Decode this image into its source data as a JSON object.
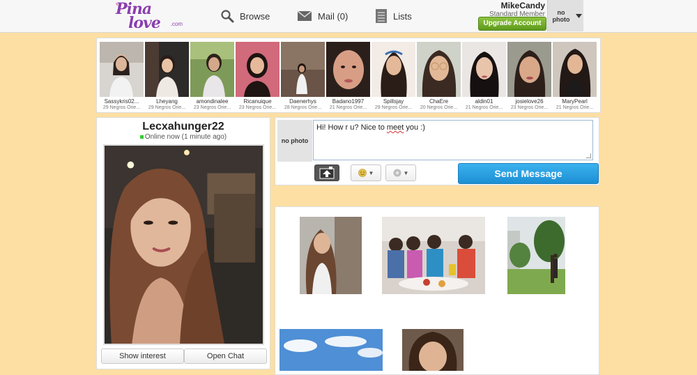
{
  "header": {
    "logo": {
      "line1": "Pina",
      "line2": "love",
      "suffix": ".com"
    },
    "nav": [
      {
        "label": "Browse",
        "icon": "search-icon"
      },
      {
        "label": "Mail (0)",
        "icon": "mail-icon"
      },
      {
        "label": "Lists",
        "icon": "list-icon"
      }
    ],
    "user": {
      "name": "MikeCandy",
      "membership": "Standard Member",
      "upgrade_label": "Upgrade Account",
      "photo_placeholder": "no photo"
    }
  },
  "strip": [
    {
      "name": "Sassykris02...",
      "meta": "29 Negros Orie..."
    },
    {
      "name": "Lheyang",
      "meta": "29 Negros Orie..."
    },
    {
      "name": "amondinalee",
      "meta": "23 Negros Orie..."
    },
    {
      "name": "Ricanuique",
      "meta": "23 Negros Orie..."
    },
    {
      "name": "Daenerhys",
      "meta": "28 Negros Orie..."
    },
    {
      "name": "Badano1997",
      "meta": "21 Negros Orie..."
    },
    {
      "name": "Spillsjay",
      "meta": "29 Negros Orie..."
    },
    {
      "name": "ChaEre",
      "meta": "20 Negros Orie..."
    },
    {
      "name": "aldin01",
      "meta": "21 Negros Orie..."
    },
    {
      "name": "josielove26",
      "meta": "23 Negros Orie..."
    },
    {
      "name": "MaryPearl",
      "meta": "21 Negros Orie..."
    }
  ],
  "profile": {
    "username": "Lecxahunger22",
    "status": "Online now (1 minute ago)",
    "show_interest_label": "Show interest",
    "open_chat_label": "Open Chat"
  },
  "message": {
    "avatar_placeholder": "no photo",
    "text_before": "Hi! How r u? Nice to ",
    "text_typo": "meet",
    "text_after": " you :)",
    "send_label": "Send Message"
  },
  "colors": {
    "background": "#fddfa3",
    "brand": "#8a3fae",
    "upgrade": "#6aa62a",
    "send": "#2aa3e4"
  }
}
